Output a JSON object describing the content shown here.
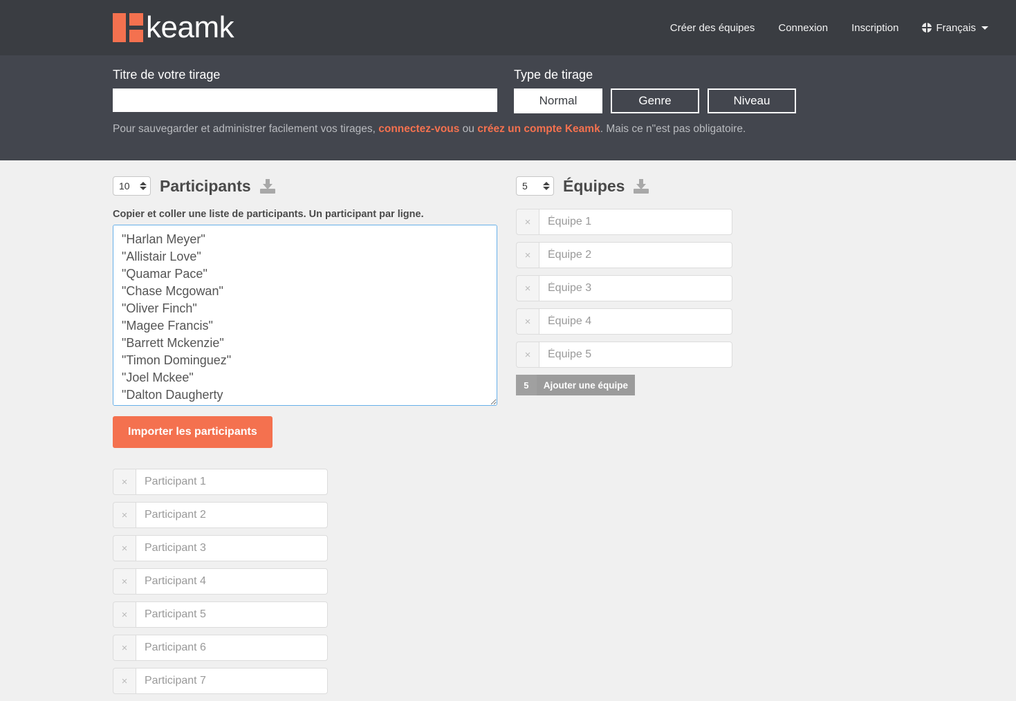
{
  "header": {
    "logo_text": "keamk",
    "logo_icon": "keamk-logo-mark",
    "nav": [
      {
        "label": "Créer des équipes",
        "name": "nav-creer-des-equipes"
      },
      {
        "label": "Connexion",
        "name": "nav-connexion"
      },
      {
        "label": "Inscription",
        "name": "nav-inscription"
      }
    ],
    "language": {
      "label": "Français",
      "icon": "globe-icon",
      "caret": "chevron-down-icon"
    }
  },
  "form": {
    "title_label": "Titre de votre tirage",
    "title_value": "",
    "title_placeholder": "",
    "type_label": "Type de tirage",
    "type_buttons": [
      {
        "label": "Normal",
        "active": true
      },
      {
        "label": "Genre",
        "active": false
      },
      {
        "label": "Niveau",
        "active": false
      }
    ],
    "note_prefix": "Pour sauvegarder et administrer facilement vos tirages, ",
    "note_link1": "connectez-vous",
    "note_middle": " ou ",
    "note_link2": "créez un compte Keamk",
    "note_suffix": ". Mais ce n\"est pas obligatoire."
  },
  "participants": {
    "count": "10",
    "title": "Participants",
    "download_icon": "download-icon",
    "paste_label": "Copier et coller une liste de participants. Un participant par ligne.",
    "paste_value": "\"Harlan Meyer\"\n\"Allistair Love\"\n\"Quamar Pace\"\n\"Chase Mcgowan\"\n\"Oliver Finch\"\n\"Magee Francis\"\n\"Barrett Mckenzie\"\n\"Timon Dominguez\"\n\"Joel Mckee\"\n\"Dalton Daugherty",
    "import_button": "Importer les participants",
    "remove_symbol": "×",
    "rows": [
      {
        "placeholder": "Participant 1",
        "value": ""
      },
      {
        "placeholder": "Participant 2",
        "value": ""
      },
      {
        "placeholder": "Participant 3",
        "value": ""
      },
      {
        "placeholder": "Participant 4",
        "value": ""
      },
      {
        "placeholder": "Participant 5",
        "value": ""
      },
      {
        "placeholder": "Participant 6",
        "value": ""
      },
      {
        "placeholder": "Participant 7",
        "value": ""
      }
    ]
  },
  "teams": {
    "count": "5",
    "title": "Équipes",
    "download_icon": "download-icon",
    "remove_symbol": "×",
    "rows": [
      {
        "placeholder": "Équipe 1",
        "value": ""
      },
      {
        "placeholder": "Équipe 2",
        "value": ""
      },
      {
        "placeholder": "Équipe 3",
        "value": ""
      },
      {
        "placeholder": "Équipe 4",
        "value": ""
      },
      {
        "placeholder": "Équipe 5",
        "value": ""
      }
    ],
    "add_count": "5",
    "add_label": "Ajouter une équipe"
  },
  "colors": {
    "accent": "#f4714f",
    "header_bg": "#3a3d42",
    "band_bg": "#43464e",
    "page_bg": "#f0f0f0",
    "focus_border": "#66afe9"
  }
}
